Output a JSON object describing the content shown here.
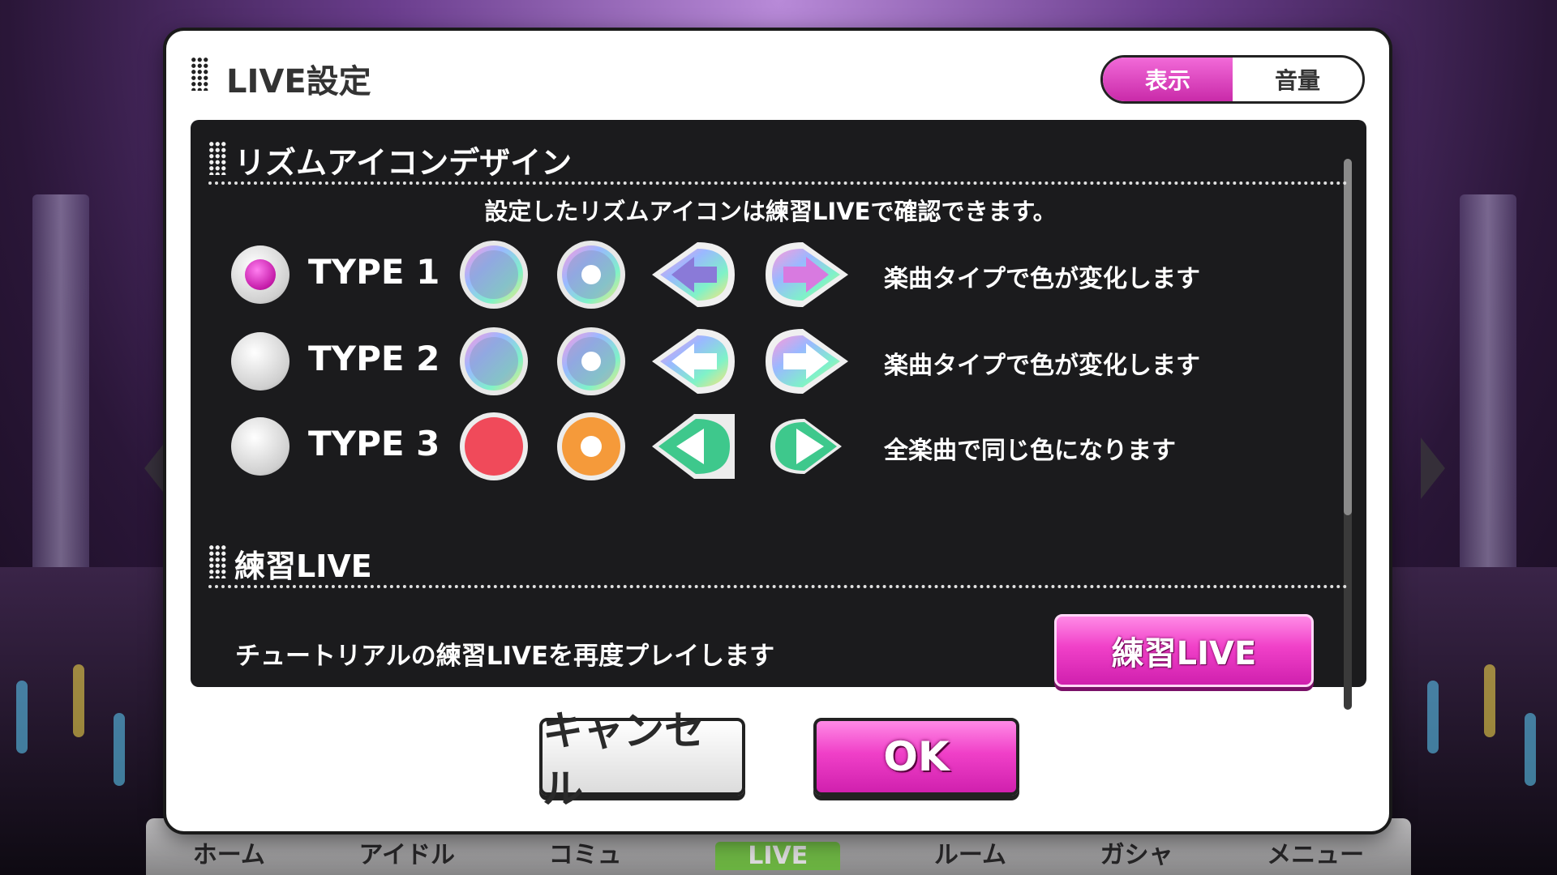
{
  "dialog": {
    "title": "LIVE設定",
    "tabs": [
      {
        "label": "表示",
        "active": true
      },
      {
        "label": "音量",
        "active": false
      }
    ]
  },
  "rhythm_section": {
    "title": "リズムアイコンデザイン",
    "note": "設定したリズムアイコンは練習LIVEで確認できます。",
    "selected": "TYPE 1",
    "types": [
      {
        "label": "TYPE 1",
        "description": "楽曲タイプで色が変化します",
        "icon_set": "gradient-colored"
      },
      {
        "label": "TYPE 2",
        "description": "楽曲タイプで色が変化します",
        "icon_set": "gradient-white-arrows"
      },
      {
        "label": "TYPE 3",
        "description": "全楽曲で同じ色になります",
        "icon_set": "flat-solid"
      }
    ]
  },
  "practice_section": {
    "title": "練習LIVE",
    "description": "チュートリアルの練習LIVEを再度プレイします",
    "button_label": "練習LIVE"
  },
  "footer": {
    "cancel_label": "キャンセル",
    "ok_label": "OK"
  },
  "bottom_nav": {
    "items": [
      "ホーム",
      "アイドル",
      "コミュ",
      "LIVE",
      "ルーム",
      "ガシャ",
      "メニュー"
    ],
    "active": "LIVE"
  },
  "colors": {
    "accent_pink": "#e03cc0",
    "panel_bg": "#0a0a0c",
    "type3_red": "#f04a5a",
    "type3_orange": "#f59a3a",
    "type3_green": "#3ec88c"
  }
}
